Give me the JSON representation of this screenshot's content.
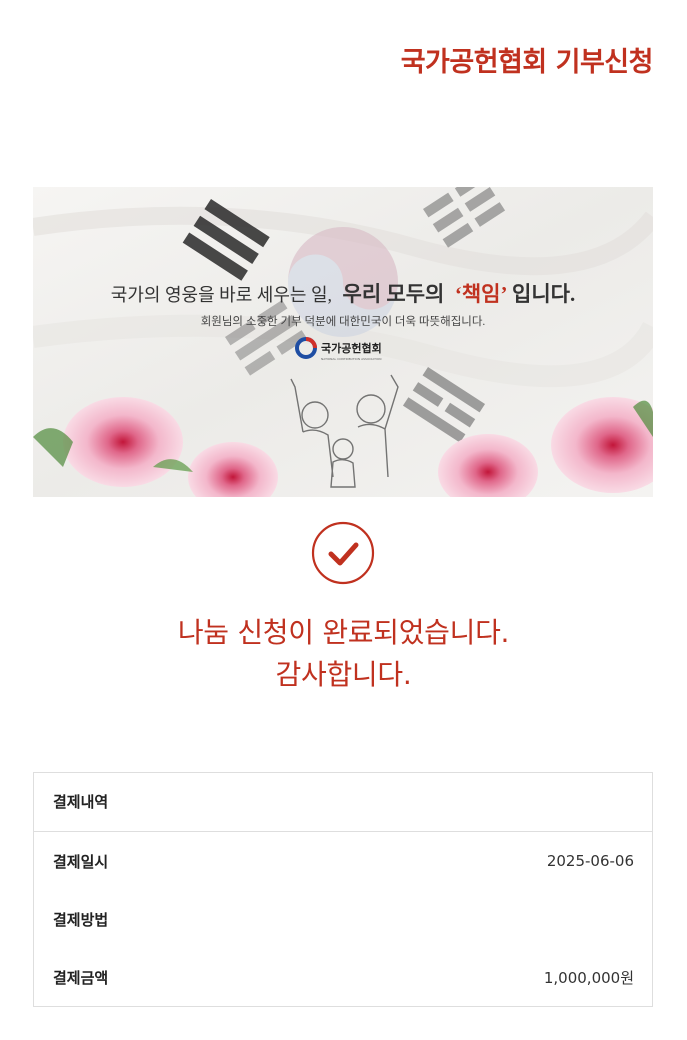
{
  "header": {
    "title": "국가공헌협회 기부신청"
  },
  "banner": {
    "headline_lead": "국가의 영웅을 바로 세우는 일,",
    "headline_strong": "우리 모두의",
    "headline_quote": "‘책임’",
    "headline_tail": "입니다.",
    "subline": "회원님의 소중한 기부 덕분에 대한민국이 더욱 따뜻해집니다.",
    "logo_text": "국가공헌협회",
    "logo_subtext": "NATIONAL CONTRIBUTION ASSOCIATION"
  },
  "status": {
    "icon": "check-circle-icon",
    "line1": "나눔 신청이 완료되었습니다.",
    "line2": "감사합니다."
  },
  "payment": {
    "title": "결제내역",
    "rows": [
      {
        "label": "결제일시",
        "value": "2025-06-06"
      },
      {
        "label": "결제방법",
        "value": ""
      },
      {
        "label": "결제금액",
        "value": "1,000,000원"
      }
    ]
  },
  "colors": {
    "accent": "#c0311f",
    "border": "#dedede"
  }
}
